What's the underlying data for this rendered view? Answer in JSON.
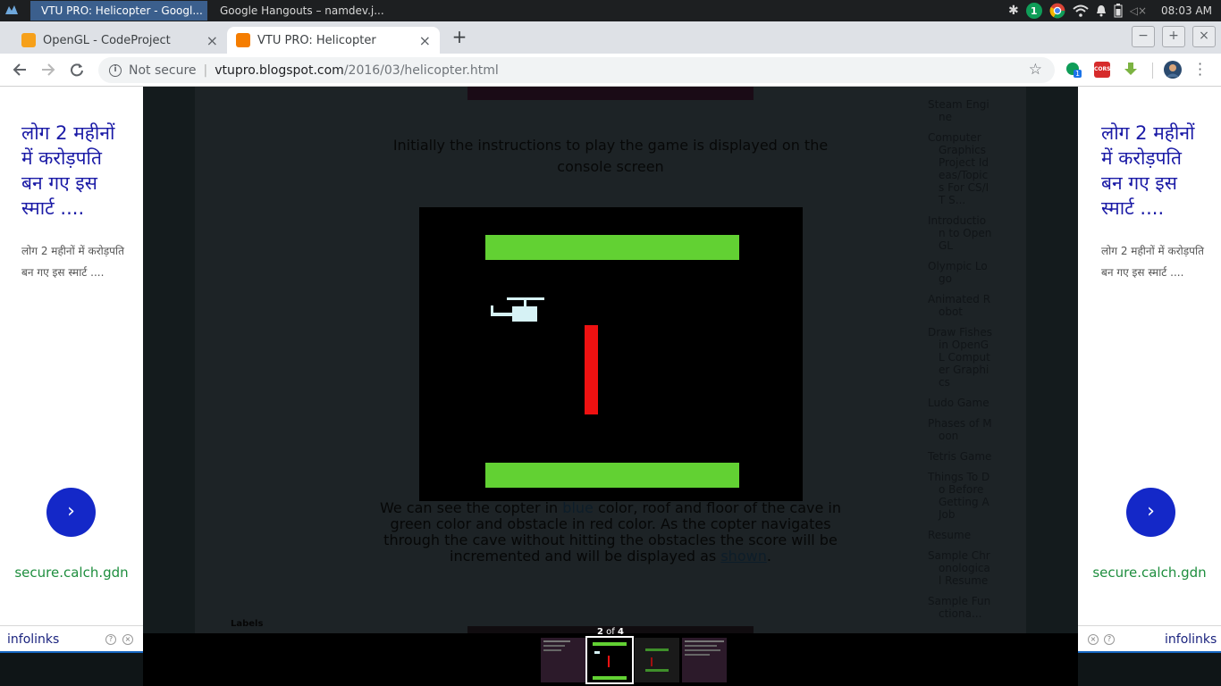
{
  "os": {
    "tasks": [
      {
        "title": "VTU PRO: Helicopter - Googl...",
        "active": true
      },
      {
        "title": "Google Hangouts – namdev.j...",
        "active": false
      }
    ],
    "notification_count": "1",
    "clock": "08:03 AM"
  },
  "browser": {
    "tabs": [
      {
        "title": "OpenGL - CodeProject",
        "active": false,
        "close": "×"
      },
      {
        "title": "VTU PRO: Helicopter",
        "active": true,
        "close": "×"
      }
    ],
    "new_tab": "+",
    "window_controls": {
      "minimize": "−",
      "maximize": "+",
      "close": "×"
    },
    "omnibox": {
      "security": "Not secure",
      "url_host": "vtupro.blogspot.com",
      "url_path": "/2016/03/helicopter.html"
    },
    "extensions": {
      "hangouts_badge": "1",
      "cors_label": "CORS"
    }
  },
  "page": {
    "intro": "Initially the instructions to play the game is displayed on the console screen",
    "caption": {
      "part1": "We can see the copter in ",
      "link1": "blue",
      "part2": " color, roof and floor of the cave in green color and obstacle in red color. As the copter navigates through the cave without hitting the obstacles the score will be incremented and will be displayed as ",
      "link2": "shown",
      "part3": "."
    },
    "labels_heading": "Labels",
    "sidebar_links": [
      "Steam Engine",
      "Computer Graphics Project Ideas/Topics For CS/IT S...",
      "Introduction to OpenGL",
      "Olympic Logo",
      "Animated Robot",
      "Draw Fishes in OpenGL Computer Graphics",
      "Ludo Game",
      "Phases of Moon",
      "Tetris Game",
      "Things To Do Before Getting A Job",
      "Resume",
      "Sample Chronological Resume",
      "Sample Functiona..."
    ]
  },
  "ads": {
    "headline": "लोग 2 महीनों में करोड़पति बन गए इस स्मार्ट ....",
    "body": "लोग 2 महीनों में करोड़पति बन गए इस स्मार्ट ....",
    "domain": "secure.calch.gdn",
    "brand": "infolinks",
    "arrow": "›",
    "help": "?",
    "close": "×"
  },
  "lightbox": {
    "counter_current": "2",
    "counter_of": "of",
    "counter_total": "4",
    "selected_index": 2
  },
  "colors": {
    "cave_green": "#62d133",
    "obstacle_red": "#ee1111",
    "copter_blue": "#d6f2f5",
    "ad_blue": "#1428c8"
  }
}
